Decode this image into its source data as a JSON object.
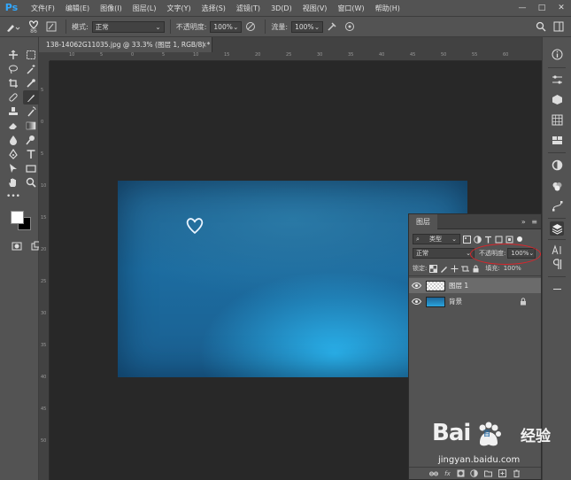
{
  "app": {
    "logo": "Ps"
  },
  "menu": [
    "文件(F)",
    "编辑(E)",
    "图像(I)",
    "图层(L)",
    "文字(Y)",
    "选择(S)",
    "滤镜(T)",
    "3D(D)",
    "视图(V)",
    "窗口(W)",
    "帮助(H)"
  ],
  "window_controls": {
    "minimize": "—",
    "maximize": "□",
    "close": "✕"
  },
  "options": {
    "brush_size": "86",
    "mode_label": "模式:",
    "mode_value": "正常",
    "opacity_label": "不透明度:",
    "opacity_value": "100%",
    "flow_label": "流量:",
    "flow_value": "100%"
  },
  "document_tab": {
    "title": "138-14062G11035.jpg @ 33.3% (图层 1, RGB/8) *",
    "close": "×"
  },
  "ruler_h_ticks": [
    "10",
    "5",
    "0",
    "5",
    "10",
    "15",
    "20",
    "25",
    "30",
    "35",
    "40",
    "45",
    "50",
    "55",
    "60"
  ],
  "ruler_v_ticks": [
    "5",
    "0",
    "5",
    "10",
    "15",
    "20",
    "25",
    "30",
    "35",
    "40",
    "45",
    "50"
  ],
  "layers_panel": {
    "tab_label": "图层",
    "menu_label": "≡",
    "collapse_label": "»",
    "filter_kind": "类型",
    "blend_mode": "正常",
    "opacity_label": "不透明度:",
    "opacity_value": "100%",
    "lock_label": "锁定:",
    "fill_label": "填充:",
    "fill_value": "100%",
    "layers": [
      {
        "name": "图层 1",
        "selected": true
      },
      {
        "name": "背景",
        "selected": false,
        "locked": true
      }
    ]
  },
  "colors": {
    "foreground": "#ffffff",
    "background": "#000000",
    "annotation": "#d8262c"
  },
  "watermark": {
    "logo": "Bai",
    "logo2": "百",
    "brand": "经验",
    "url": "jingyan.baidu.com"
  }
}
